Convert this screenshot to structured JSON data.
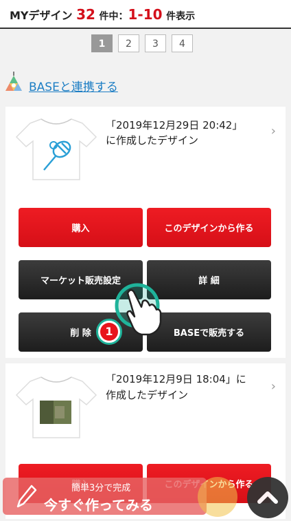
{
  "header": {
    "title_prefix": "MYデザイン",
    "total": "32",
    "total_unit": "件中：",
    "range": "1-10",
    "range_unit": "件表示"
  },
  "pagination": {
    "pages": [
      "1",
      "2",
      "3",
      "4"
    ],
    "current": "1"
  },
  "base_link": {
    "label": "BASEと連携する"
  },
  "designs": [
    {
      "date_line1": "「2019年12月29日 20:42」",
      "date_line2": "に作成したデザイン",
      "buy_label": "購入",
      "create_label": "このデザインから作る",
      "market_label": "マーケット販売設定",
      "detail_label": "詳 細",
      "delete_label": "削 除",
      "base_sell_label": "BASEで販売する"
    },
    {
      "date_line1": "「2019年12月9日 18:04」に",
      "date_line2": "作成したデザイン",
      "buy_label": "購入",
      "create_label": "このデザインから作る"
    }
  ],
  "tutorial": {
    "step_number": "1"
  },
  "floating_cta": {
    "sub_label": "簡単3分で完成",
    "main_label": "今すぐ作ってみる"
  },
  "colors": {
    "accent_red": "#d4101b",
    "link_blue": "#1d7ec4",
    "dark_button": "#2a2a2a",
    "teal_ring": "#1fb39a"
  }
}
